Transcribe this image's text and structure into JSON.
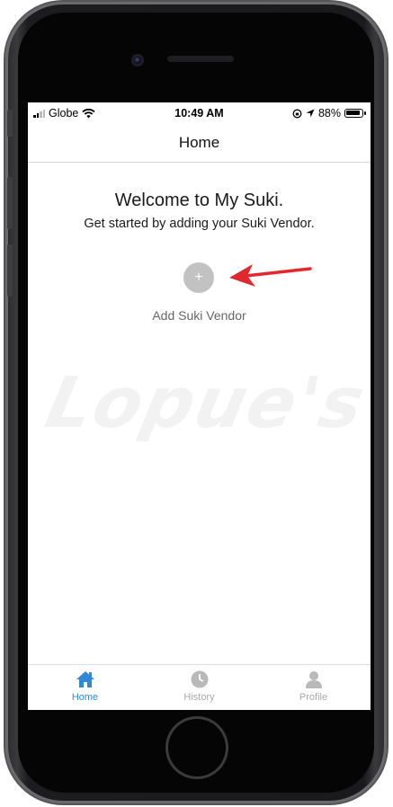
{
  "status_bar": {
    "carrier": "Globe",
    "time": "10:49 AM",
    "battery": "88%"
  },
  "nav": {
    "title": "Home"
  },
  "main": {
    "welcome": "Welcome to My Suki.",
    "subtitle": "Get started by adding your Suki Vendor.",
    "add_button_symbol": "+",
    "add_label": "Add Suki Vendor",
    "watermark": "Lopue's"
  },
  "tabs": [
    {
      "label": "Home",
      "icon": "home-icon",
      "active": true
    },
    {
      "label": "History",
      "icon": "clock-icon",
      "active": false
    },
    {
      "label": "Profile",
      "icon": "person-icon",
      "active": false
    }
  ],
  "colors": {
    "accent": "#2e8ad8",
    "arrow": "#e0282e",
    "inactive_tab": "#a8a8a8"
  }
}
